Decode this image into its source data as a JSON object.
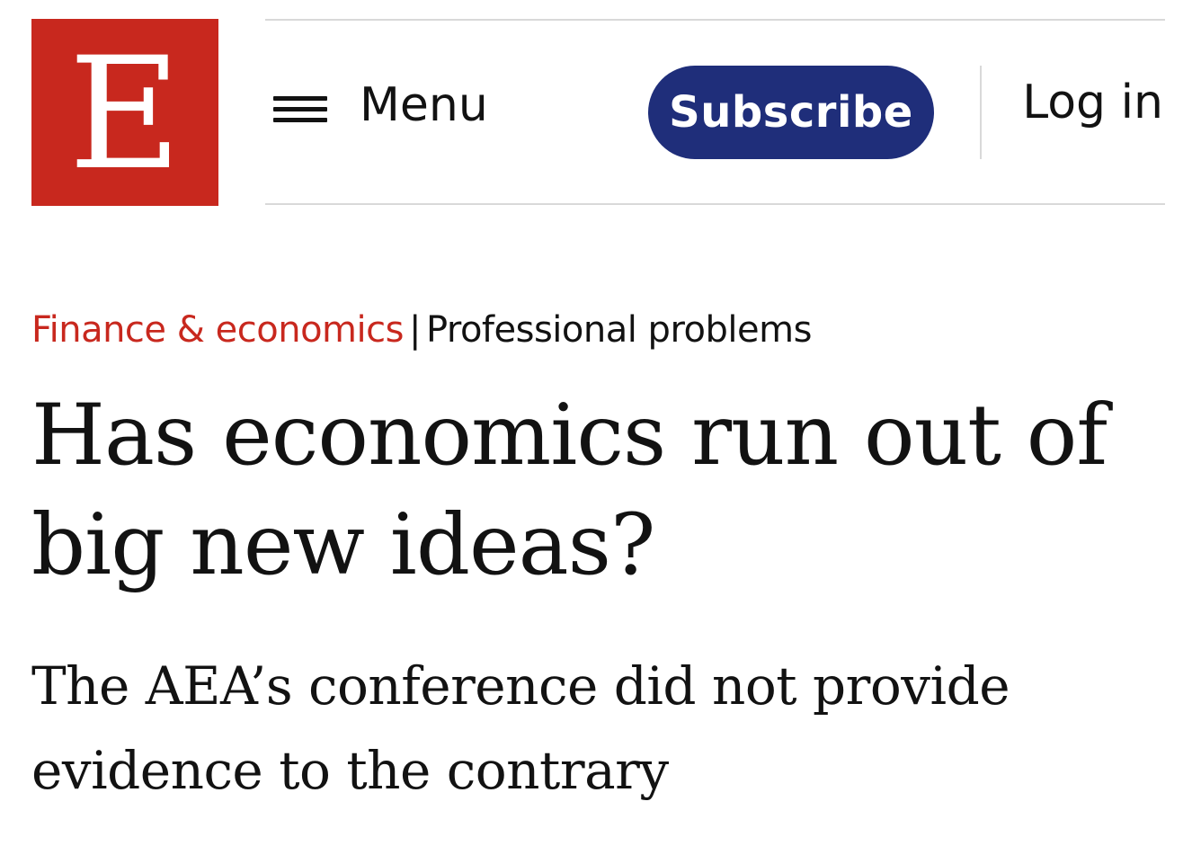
{
  "header": {
    "logo_letter": "E",
    "menu_label": "Menu",
    "subscribe_label": "Subscribe",
    "login_label": "Log in"
  },
  "article": {
    "section": "Finance & economics",
    "separator": "|",
    "flytitle": "Professional problems",
    "headline_line1": "Has economics run out of",
    "headline_line2": "big new ideas?",
    "subheadline_line1": "The AEA’s conference did not provide",
    "subheadline_line2": "evidence to the contrary"
  },
  "colors": {
    "brand_red": "#c8281e",
    "subscribe_navy": "#1f2e7a",
    "text": "#121212",
    "rule": "#d9d9d9"
  },
  "icons": {
    "menu": "hamburger-icon"
  }
}
